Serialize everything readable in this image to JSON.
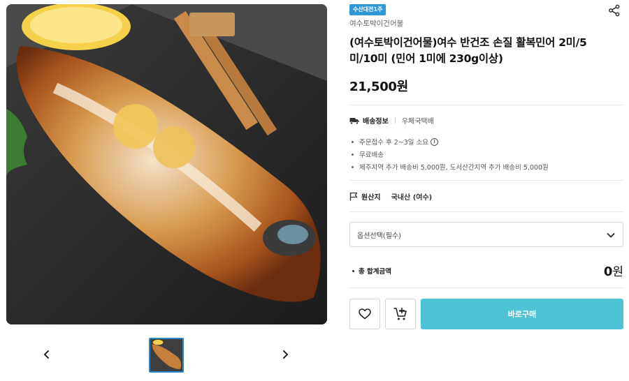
{
  "product": {
    "badge": "수산대전1주",
    "seller": "여수토박이건어물",
    "title": "(여수토박이건어물)여수 반건조 손질 활복민어 2미/5미/10미 (민어 1미에 230g이상)",
    "price": "21,500원"
  },
  "shipping": {
    "label": "배송정보",
    "value": "우체국택배",
    "notes": [
      "주문접수 후 2~3일 소요",
      "무료배송",
      "제주지역 추가 배송비 5,000원, 도서산간지역 추가 배송비 5,000원"
    ]
  },
  "origin": {
    "label": "원산지",
    "value": "국내산 (여수)"
  },
  "option": {
    "placeholder": "옵션선택(필수)"
  },
  "total": {
    "label": "총 합계금액",
    "amount": "0",
    "unit": "원"
  },
  "actions": {
    "buy_label": "바로구매"
  },
  "icons": {
    "share": "share-icon",
    "truck": "truck-icon",
    "flag": "flag-icon",
    "info": "info-icon",
    "chevron": "chevron-down-icon",
    "heart": "heart-icon",
    "cart": "cart-add-icon",
    "prev": "chevron-left-icon",
    "next": "chevron-right-icon"
  },
  "colors": {
    "badge": "#2f97d6",
    "buy_button": "#4ec3d6",
    "thumb_border": "#2f86c8"
  }
}
